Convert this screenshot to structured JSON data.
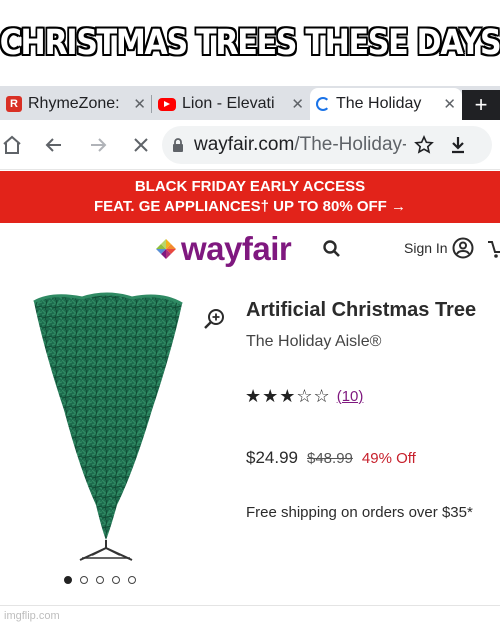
{
  "meme": {
    "caption": "CHRISTMAS TREES THESE DAYS",
    "watermark": "imgflip.com"
  },
  "browser": {
    "tabs": [
      {
        "title": "RhymeZone:",
        "icon": "rhymezone-favicon",
        "active": false
      },
      {
        "title": "Lion - Elevati",
        "icon": "youtube-favicon",
        "active": false
      },
      {
        "title": "The Holiday",
        "icon": "loading-spinner",
        "active": true
      }
    ],
    "close_glyph": "✕",
    "new_tab_glyph": "+",
    "url_domain": "wayfair.com",
    "url_path": "/The-Holiday-Aisle"
  },
  "banner": {
    "line1": "BLACK FRIDAY EARLY ACCESS",
    "line2": "FEAT. GE APPLIANCES† UP TO 80% OFF →",
    "color": "#e2231a"
  },
  "site": {
    "logo": "wayfair",
    "signin": "Sign In",
    "brand_color": "#7f187f"
  },
  "product": {
    "title": "Artificial Christmas Tree",
    "brand": "The Holiday Aisle®",
    "rating_filled": "★★★",
    "rating_empty": "☆☆",
    "rating": 3,
    "rating_max": 5,
    "reviews": "(10)",
    "price": "$24.99",
    "old_price": "$48.99",
    "discount": "49% Off",
    "shipping": "Free shipping on orders over $35*",
    "image_count": 5,
    "image_index": 1
  }
}
